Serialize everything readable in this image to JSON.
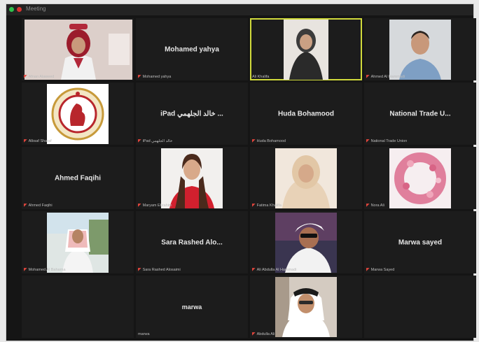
{
  "window": {
    "title": "Meeting"
  },
  "participants": [
    {
      "tile_name": "",
      "label": "Afnan Alaweed",
      "photo": "woman-hijab-red-room",
      "muted": true
    },
    {
      "tile_name": "Mohamed yahya",
      "label": "Mohamed yahya",
      "photo": "",
      "muted": true
    },
    {
      "tile_name": "",
      "label": "Ali Khalifa",
      "photo": "woman-hijab-window",
      "muted": false,
      "active_speaker": true
    },
    {
      "tile_name": "",
      "label": "Ahmed Al Hammadi",
      "photo": "man-blue-shirt",
      "muted": true
    },
    {
      "tile_name": "",
      "label": "Albsaf Sharaf",
      "photo": "red-logo-emblem",
      "muted": true
    },
    {
      "tile_name": "iPad خالد الجلهمي ...",
      "label": "iPad خالد الجلهمي",
      "photo": "",
      "muted": true
    },
    {
      "tile_name": "Huda Bohamood",
      "label": "Huda Bohamood",
      "photo": "",
      "muted": true
    },
    {
      "tile_name": "National Trade U...",
      "label": "National Trade Union",
      "photo": "",
      "muted": true
    },
    {
      "tile_name": "Ahmed Faqihi",
      "label": "Ahmed Faqihi",
      "photo": "",
      "muted": true
    },
    {
      "tile_name": "",
      "label": "Maryam Ebrahim",
      "photo": "woman-red-blazer",
      "muted": true
    },
    {
      "tile_name": "",
      "label": "Fatima Khalifa",
      "photo": "woman-hijab-beige",
      "muted": true
    },
    {
      "tile_name": "",
      "label": "Nora Ali",
      "photo": "pink-flower-wreath",
      "muted": true
    },
    {
      "tile_name": "",
      "label": "Mohamed Al Baharna",
      "photo": "man-ghutra-outdoor",
      "muted": true
    },
    {
      "tile_name": "Sara Rashed Alo...",
      "label": "Sara Rashed Alosaimi",
      "photo": "",
      "muted": true
    },
    {
      "tile_name": "",
      "label": "Ali Abdulla Al Hammadi",
      "photo": "man-dark-glasses",
      "muted": true
    },
    {
      "tile_name": "Marwa sayed",
      "label": "Marwa Sayed",
      "photo": "",
      "muted": true
    },
    {
      "tile_name": "",
      "label": "",
      "photo": "",
      "empty": true
    },
    {
      "tile_name": "marwa",
      "label": "marwa",
      "photo": "",
      "muted": false
    },
    {
      "tile_name": "",
      "label": "Abdulla Ali",
      "photo": "man-ghutra-white",
      "muted": true
    },
    {
      "tile_name": "",
      "label": "",
      "photo": "",
      "empty": true
    }
  ],
  "icons": {
    "muted": "mic-muted-icon"
  },
  "colors": {
    "active_border": "#d0da3b",
    "muted_icon": "#e2463d",
    "tile_bg": "#1c1c1c"
  }
}
